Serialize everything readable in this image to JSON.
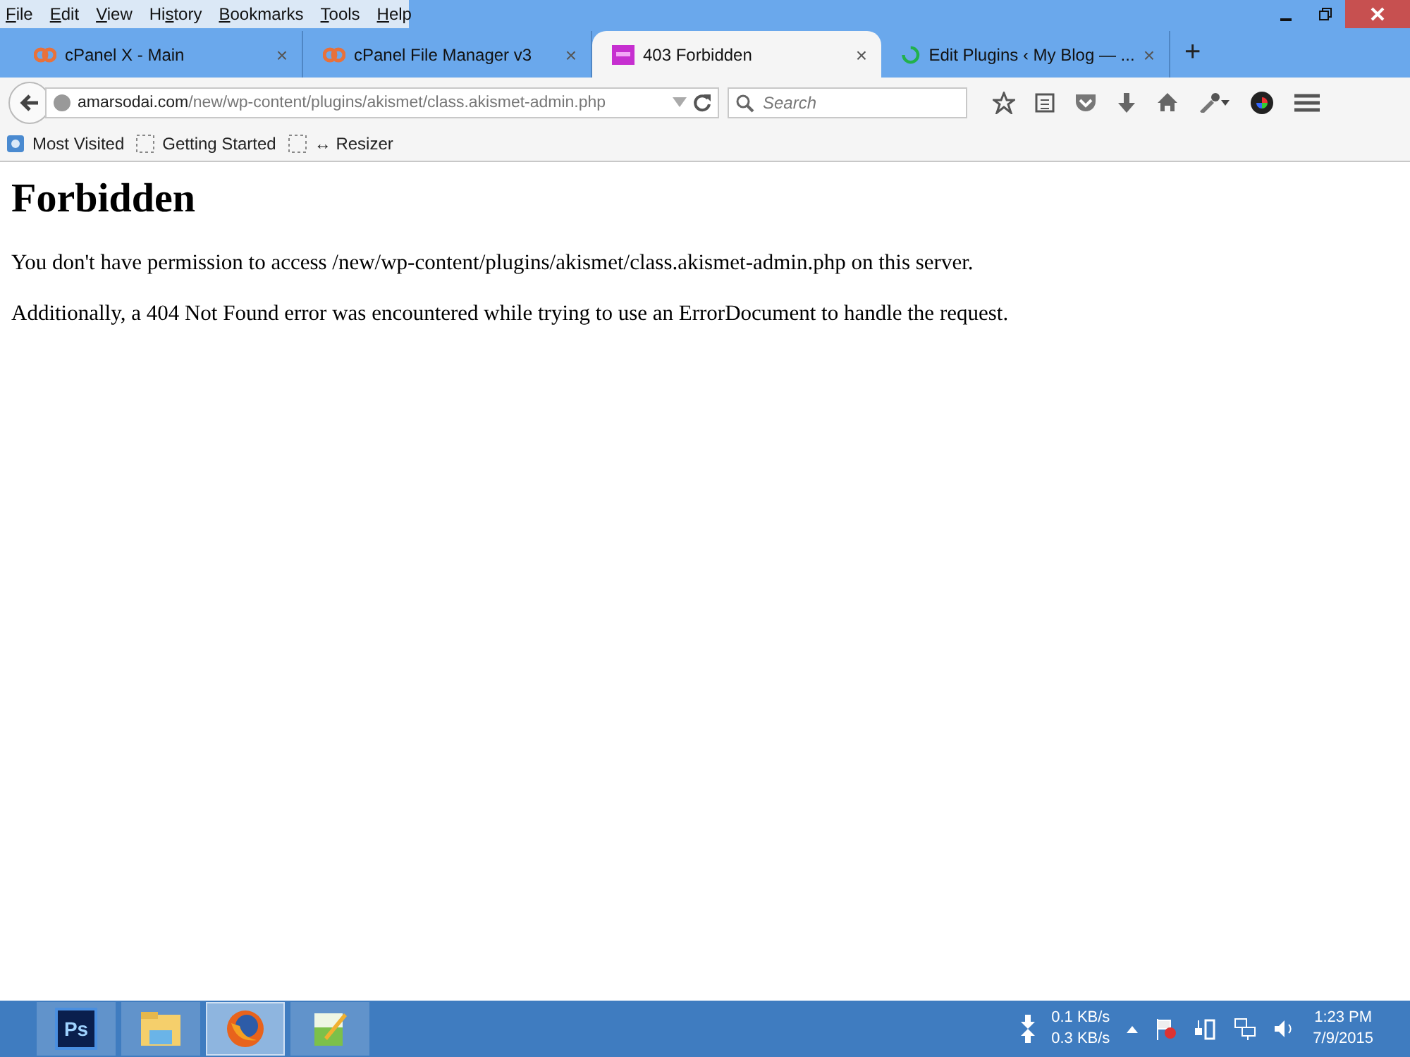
{
  "menu": [
    {
      "key": "F",
      "after": "ile"
    },
    {
      "key": "E",
      "after": "dit"
    },
    {
      "key": "V",
      "after": "iew"
    },
    {
      "before": "Hi",
      "key": "s",
      "after": "tory"
    },
    {
      "key": "B",
      "after": "ookmarks"
    },
    {
      "key": "T",
      "after": "ools"
    },
    {
      "key": "H",
      "after": "elp"
    }
  ],
  "tabs": [
    {
      "label": "cPanel X - Main",
      "kind": "cpanel",
      "selected": false,
      "close": "×"
    },
    {
      "label": "cPanel File Manager v3",
      "kind": "cpanel",
      "selected": false,
      "close": "×"
    },
    {
      "label": "403 Forbidden",
      "kind": "page",
      "selected": true,
      "close": "×"
    },
    {
      "label": "Edit Plugins ‹ My Blog — ...",
      "kind": "loading",
      "selected": false,
      "close": "×"
    }
  ],
  "new_tab": "+",
  "address": {
    "domain": "amarsodai.com",
    "path": "/new/wp-content/plugins/akismet/class.akismet-admin.php"
  },
  "search": {
    "placeholder": "Search"
  },
  "bookmarks": [
    {
      "label": "Most Visited",
      "kind": "folder"
    },
    {
      "label": "Getting Started",
      "kind": "blank"
    },
    {
      "label": "↔ Resizer",
      "kind": "blank"
    }
  ],
  "page": {
    "heading": "Forbidden",
    "paragraphs": [
      "You don't have permission to access /new/wp-content/plugins/akismet/class.akismet-admin.php on this server.",
      "Additionally, a 404 Not Found error was encountered while trying to use an ErrorDocument to handle the request."
    ]
  },
  "taskbar": {
    "apps": [
      {
        "kind": "photoshop",
        "label": "Ps",
        "selected": false
      },
      {
        "kind": "explorer",
        "selected": false
      },
      {
        "kind": "firefox",
        "selected": true
      },
      {
        "kind": "notepad",
        "selected": false
      }
    ],
    "download_speed": "0.1 KB/s",
    "upload_speed": "0.3 KB/s",
    "time": "1:23 PM",
    "date": "7/9/2015"
  }
}
